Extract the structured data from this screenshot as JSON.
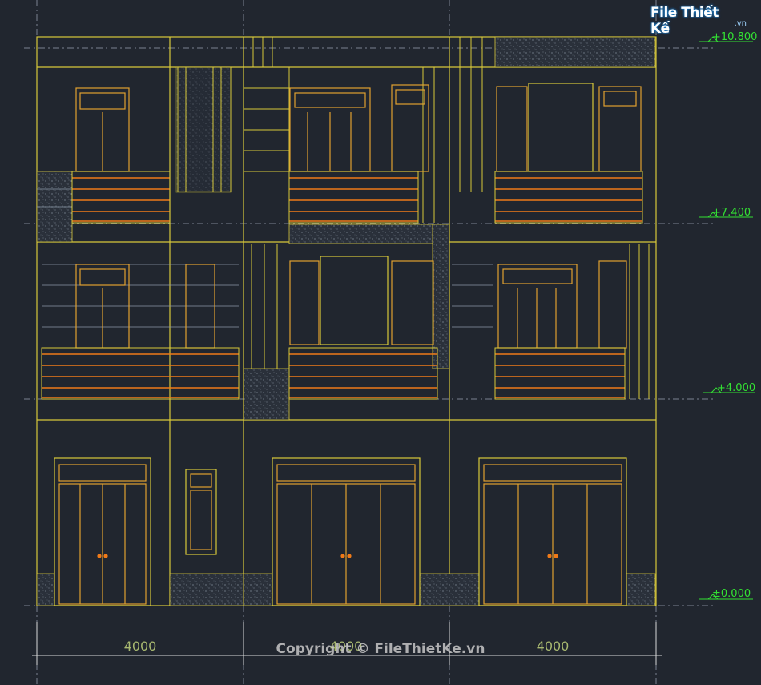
{
  "watermark": {
    "logo_text": "File Thiết Kế",
    "logo_suffix": ".vn",
    "copyright": "Copyright © FileThietKe.vn"
  },
  "levels": [
    {
      "label": "+10.800"
    },
    {
      "label": "+7.400"
    },
    {
      "label": "+4.000"
    },
    {
      "label": "±0.000"
    }
  ],
  "dimensions": [
    "4000",
    "4000",
    "4000"
  ],
  "colors": {
    "background": "#21262f",
    "outline": "#d8c83a",
    "frame": "#e0a030",
    "railing": "#f07a18",
    "hatch": "#8c98a8",
    "level_text": "#33e033",
    "dim_text": "#a8b870",
    "axis": "#7a8290"
  }
}
